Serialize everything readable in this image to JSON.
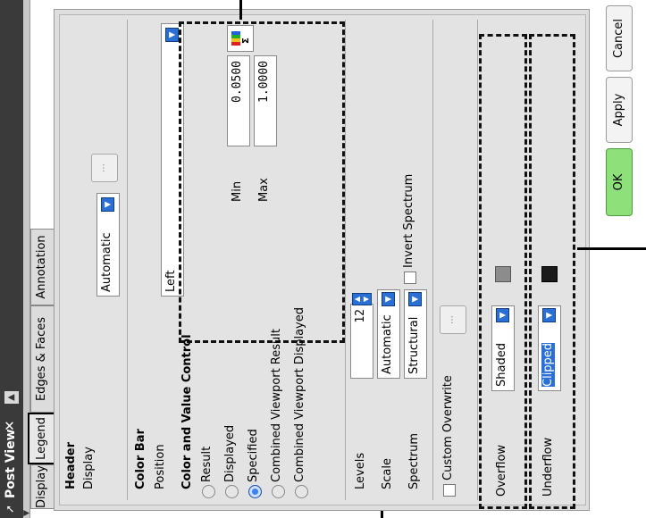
{
  "window": {
    "title": "Post View"
  },
  "tabs": [
    {
      "label": "Display"
    },
    {
      "label": "Legend"
    },
    {
      "label": "Edges & Faces"
    },
    {
      "label": "Annotation"
    }
  ],
  "header": {
    "title": "Header",
    "display_label": "Display",
    "display_value": "Automatic"
  },
  "color_bar": {
    "title": "Color Bar",
    "position_label": "Position",
    "position_value": "Left"
  },
  "color_value": {
    "title": "Color and Value Control",
    "options": [
      "Result",
      "Displayed",
      "Specified",
      "Combined Viewport Result",
      "Combined Viewport Displayed"
    ],
    "selected": "Specified",
    "min_label": "Min",
    "min_value": "0.0500",
    "max_label": "Max",
    "max_value": "1.0000"
  },
  "levels": {
    "label": "Levels",
    "value": "12"
  },
  "scale": {
    "label": "Scale",
    "value": "Automatic"
  },
  "spectrum": {
    "label": "Spectrum",
    "value": "Structural",
    "invert_label": "Invert Spectrum"
  },
  "custom_overwrite": {
    "label": "Custom Overwrite"
  },
  "overflow": {
    "label": "Overflow",
    "value": "Shaded",
    "color": "#8c8c8c"
  },
  "underflow": {
    "label": "Underflow",
    "value": "Clipped",
    "color": "#1a1a1a"
  },
  "buttons": {
    "ok": "OK",
    "apply": "Apply",
    "cancel": "Cancel"
  },
  "icons": [
    "pin-icon",
    "close-icon",
    "scroll-up-icon",
    "scroll-down-icon",
    "dropdown-icon",
    "spectrum-icon",
    "more-icon"
  ],
  "accent_colors": {
    "ok_button": "#8ee07a",
    "selection": "#2a6fd6"
  }
}
